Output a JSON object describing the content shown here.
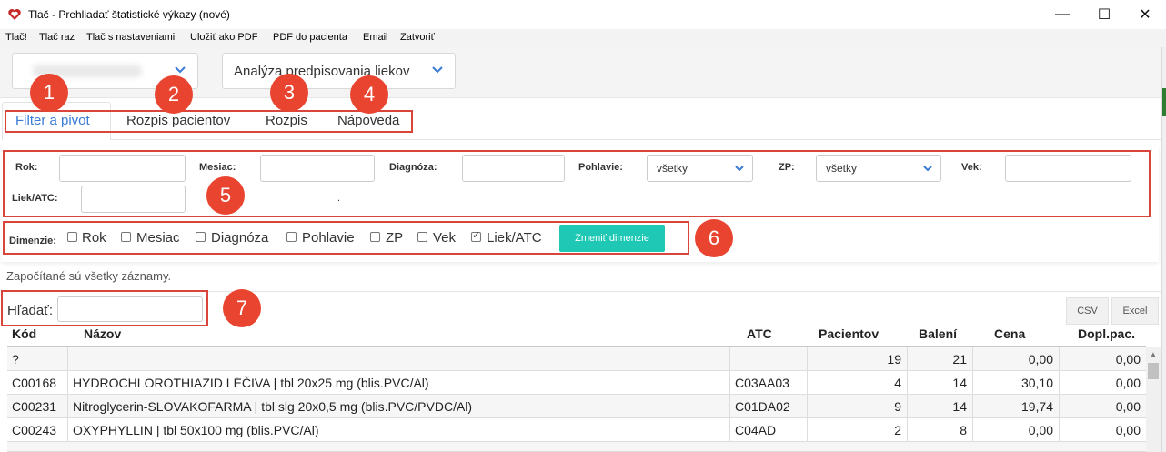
{
  "window": {
    "title": "Tlač - Prehliadať štatistické výkazy (nové)",
    "controls": {
      "minimize": "—",
      "maximize": "☐",
      "close": "✕"
    }
  },
  "menu": [
    "Tlač!",
    "Tlač raz",
    "Tlač s nastaveniami",
    "Uložiť ako PDF",
    "PDF do pacienta",
    "Email",
    "Zatvoriť"
  ],
  "topbar": {
    "report_select": "Analýza predpisovania liekov"
  },
  "tabs": [
    "Filter a pivot",
    "Rozpis pacientov",
    "Rozpis",
    "Nápoveda"
  ],
  "badges": [
    "1",
    "2",
    "3",
    "4",
    "5",
    "6",
    "7"
  ],
  "filters": {
    "rok": "Rok:",
    "mesiac": "Mesiac:",
    "diagnoza": "Diagnóza:",
    "pohlavie": "Pohlavie:",
    "pohlavie_value": "všetky",
    "zp": "ZP:",
    "zp_value": "všetky",
    "vek": "Vek:",
    "liek": "Liek/ATC:",
    "dot": "."
  },
  "dimensions": {
    "label": "Dimenzie:",
    "items": [
      {
        "label": "Rok",
        "checked": false
      },
      {
        "label": "Mesiac",
        "checked": false
      },
      {
        "label": "Diagnóza",
        "checked": false
      },
      {
        "label": "Pohlavie",
        "checked": false
      },
      {
        "label": "ZP",
        "checked": false
      },
      {
        "label": "Vek",
        "checked": false
      },
      {
        "label": "Liek/ATC",
        "checked": true
      }
    ],
    "button": "Zmeniť dimenzie"
  },
  "status_text": "Započítané sú všetky záznamy.",
  "search": {
    "label": "Hľadať:",
    "value": ""
  },
  "export": {
    "csv": "CSV",
    "excel": "Excel"
  },
  "table": {
    "headers": [
      "Kód",
      "Názov",
      "ATC",
      "Pacientov",
      "Balení",
      "Cena",
      "Dopl.pac."
    ],
    "rows": [
      [
        "?",
        "",
        "",
        "19",
        "21",
        "0,00",
        "0,00"
      ],
      [
        "C00168",
        "HYDROCHLOROTHIAZID LÉČIVA | tbl 20x25 mg (blis.PVC/Al)",
        "C03AA03",
        "4",
        "14",
        "30,10",
        "0,00"
      ],
      [
        "C00231",
        "Nitroglycerin-SLOVAKOFARMA | tbl slg 20x0,5 mg (blis.PVC/PVDC/Al)",
        "C01DA02",
        "9",
        "14",
        "19,74",
        "0,00"
      ],
      [
        "C00243",
        "OXYPHYLLIN | tbl 50x100 mg (blis.PVC/Al)",
        "C04AD",
        "2",
        "8",
        "0,00",
        "0,00"
      ]
    ]
  },
  "colors": {
    "accent_tab": "#3a7bd5",
    "button_teal": "#1fc8b4",
    "annotation_red": "#e8442f"
  }
}
